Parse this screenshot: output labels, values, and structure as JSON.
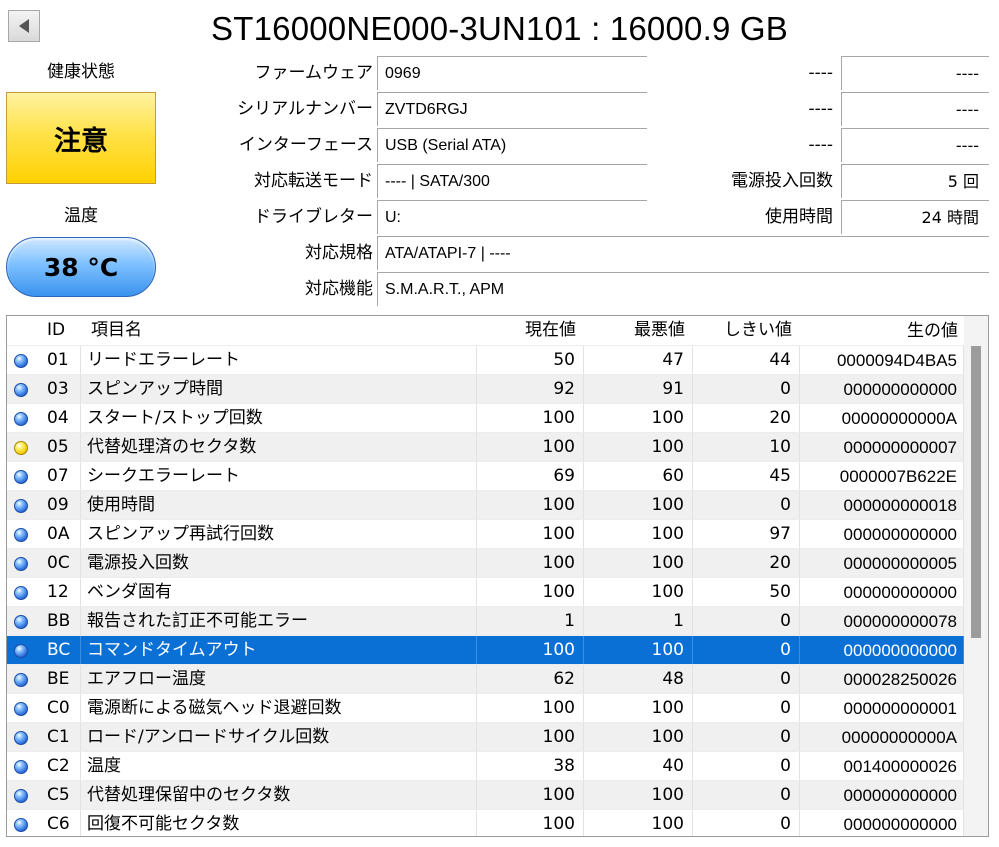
{
  "window": {
    "title": "ST16000NE000-3UN101 : 16000.9 GB"
  },
  "status": {
    "health_label": "健康状態",
    "health_value": "注意",
    "temp_label": "温度",
    "temp_value": "38 °C",
    "colors": {
      "caution": "#ffd000",
      "temperature": "#3a92ee",
      "selection": "#0a70d6"
    }
  },
  "info": {
    "firmware": {
      "label": "ファームウェア",
      "value": "0969"
    },
    "serial": {
      "label": "シリアルナンバー",
      "value": "ZVTD6RGJ"
    },
    "interface": {
      "label": "インターフェース",
      "value": "USB (Serial ATA)"
    },
    "transfer_mode": {
      "label": "対応転送モード",
      "value": "---- | SATA/300"
    },
    "drive_letter": {
      "label": "ドライブレター",
      "value": "U:"
    },
    "standard": {
      "label": "対応規格",
      "value": "ATA/ATAPI-7 | ----"
    },
    "features": {
      "label": "対応機能",
      "value": "S.M.A.R.T., APM"
    }
  },
  "right_info": {
    "row1": {
      "label": "----",
      "value": "----"
    },
    "row2": {
      "label": "----",
      "value": "----"
    },
    "row3": {
      "label": "----",
      "value": "----"
    },
    "power_on_count": {
      "label": "電源投入回数",
      "value": "5 回"
    },
    "power_on_hours": {
      "label": "使用時間",
      "value": "24 時間"
    }
  },
  "table": {
    "headers": {
      "id": "ID",
      "name": "項目名",
      "current": "現在値",
      "worst": "最悪値",
      "threshold": "しきい値",
      "raw": "生の値"
    },
    "rows": [
      {
        "status": "good",
        "id": "01",
        "name": "リードエラーレート",
        "current": "50",
        "worst": "47",
        "threshold": "44",
        "raw": "0000094D4BA5"
      },
      {
        "status": "good",
        "id": "03",
        "name": "スピンアップ時間",
        "current": "92",
        "worst": "91",
        "threshold": "0",
        "raw": "000000000000"
      },
      {
        "status": "good",
        "id": "04",
        "name": "スタート/ストップ回数",
        "current": "100",
        "worst": "100",
        "threshold": "20",
        "raw": "00000000000A"
      },
      {
        "status": "caution",
        "id": "05",
        "name": "代替処理済のセクタ数",
        "current": "100",
        "worst": "100",
        "threshold": "10",
        "raw": "000000000007"
      },
      {
        "status": "good",
        "id": "07",
        "name": "シークエラーレート",
        "current": "69",
        "worst": "60",
        "threshold": "45",
        "raw": "0000007B622E"
      },
      {
        "status": "good",
        "id": "09",
        "name": "使用時間",
        "current": "100",
        "worst": "100",
        "threshold": "0",
        "raw": "000000000018"
      },
      {
        "status": "good",
        "id": "0A",
        "name": "スピンアップ再試行回数",
        "current": "100",
        "worst": "100",
        "threshold": "97",
        "raw": "000000000000"
      },
      {
        "status": "good",
        "id": "0C",
        "name": "電源投入回数",
        "current": "100",
        "worst": "100",
        "threshold": "20",
        "raw": "000000000005"
      },
      {
        "status": "good",
        "id": "12",
        "name": "ベンダ固有",
        "current": "100",
        "worst": "100",
        "threshold": "50",
        "raw": "000000000000"
      },
      {
        "status": "good",
        "id": "BB",
        "name": "報告された訂正不可能エラー",
        "current": "1",
        "worst": "1",
        "threshold": "0",
        "raw": "000000000078"
      },
      {
        "status": "good",
        "id": "BC",
        "name": "コマンドタイムアウト",
        "current": "100",
        "worst": "100",
        "threshold": "0",
        "raw": "000000000000",
        "selected": true
      },
      {
        "status": "good",
        "id": "BE",
        "name": "エアフロー温度",
        "current": "62",
        "worst": "48",
        "threshold": "0",
        "raw": "000028250026"
      },
      {
        "status": "good",
        "id": "C0",
        "name": "電源断による磁気ヘッド退避回数",
        "current": "100",
        "worst": "100",
        "threshold": "0",
        "raw": "000000000001"
      },
      {
        "status": "good",
        "id": "C1",
        "name": "ロード/アンロードサイクル回数",
        "current": "100",
        "worst": "100",
        "threshold": "0",
        "raw": "00000000000A"
      },
      {
        "status": "good",
        "id": "C2",
        "name": "温度",
        "current": "38",
        "worst": "40",
        "threshold": "0",
        "raw": "001400000026"
      },
      {
        "status": "good",
        "id": "C5",
        "name": "代替処理保留中のセクタ数",
        "current": "100",
        "worst": "100",
        "threshold": "0",
        "raw": "000000000000"
      },
      {
        "status": "good",
        "id": "C6",
        "name": "回復不可能セクタ数",
        "current": "100",
        "worst": "100",
        "threshold": "0",
        "raw": "000000000000"
      }
    ]
  }
}
